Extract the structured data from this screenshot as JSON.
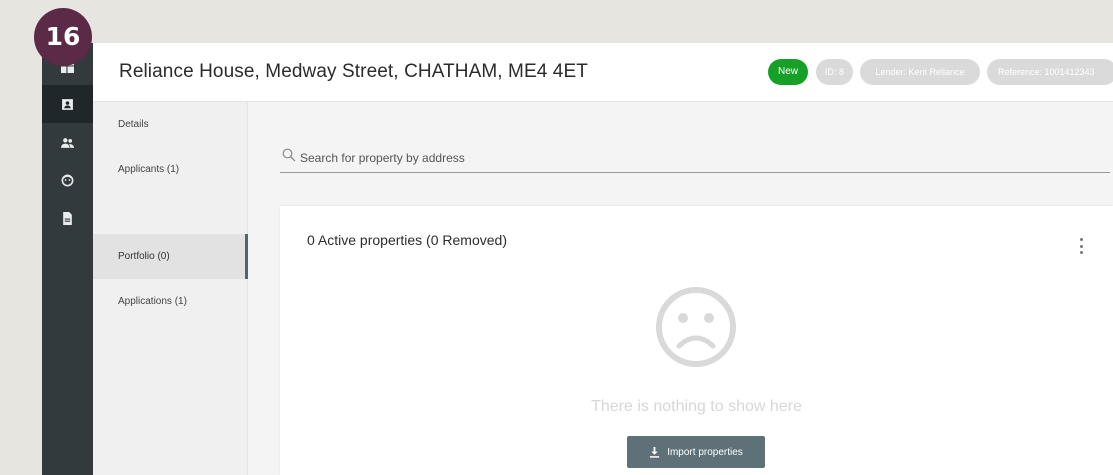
{
  "step_badge": "16",
  "rail": {
    "items": [
      {
        "icon": "dashboard-icon"
      },
      {
        "icon": "contact-card-icon",
        "active": true
      },
      {
        "icon": "people-icon"
      },
      {
        "icon": "face-icon"
      },
      {
        "icon": "document-icon"
      }
    ]
  },
  "header": {
    "title": "Reliance House, Medway Street, CHATHAM, ME4 4ET",
    "badges": {
      "status": "New",
      "id": "ID: 8",
      "lender": "Lender: Kent Reliance",
      "reference": "Reference: 1001412343"
    }
  },
  "subnav": {
    "items": [
      {
        "label": "Details"
      },
      {
        "label": "Applicants (1)"
      },
      {
        "label": "Portfolio (0)",
        "active": true
      },
      {
        "label": "Applications (1)"
      }
    ]
  },
  "search": {
    "placeholder": "Search for property by address",
    "value": ""
  },
  "card": {
    "title": "0 Active properties (0 Removed)",
    "empty_icon": "sad-face-icon",
    "empty_message": "There is nothing to show here",
    "import_label": "Import properties",
    "import_icon": "download-icon"
  },
  "colors": {
    "rail": "#323a3e",
    "status_new": "#17a028",
    "badge_muted": "#dadada",
    "primary_button": "#5e7179"
  }
}
